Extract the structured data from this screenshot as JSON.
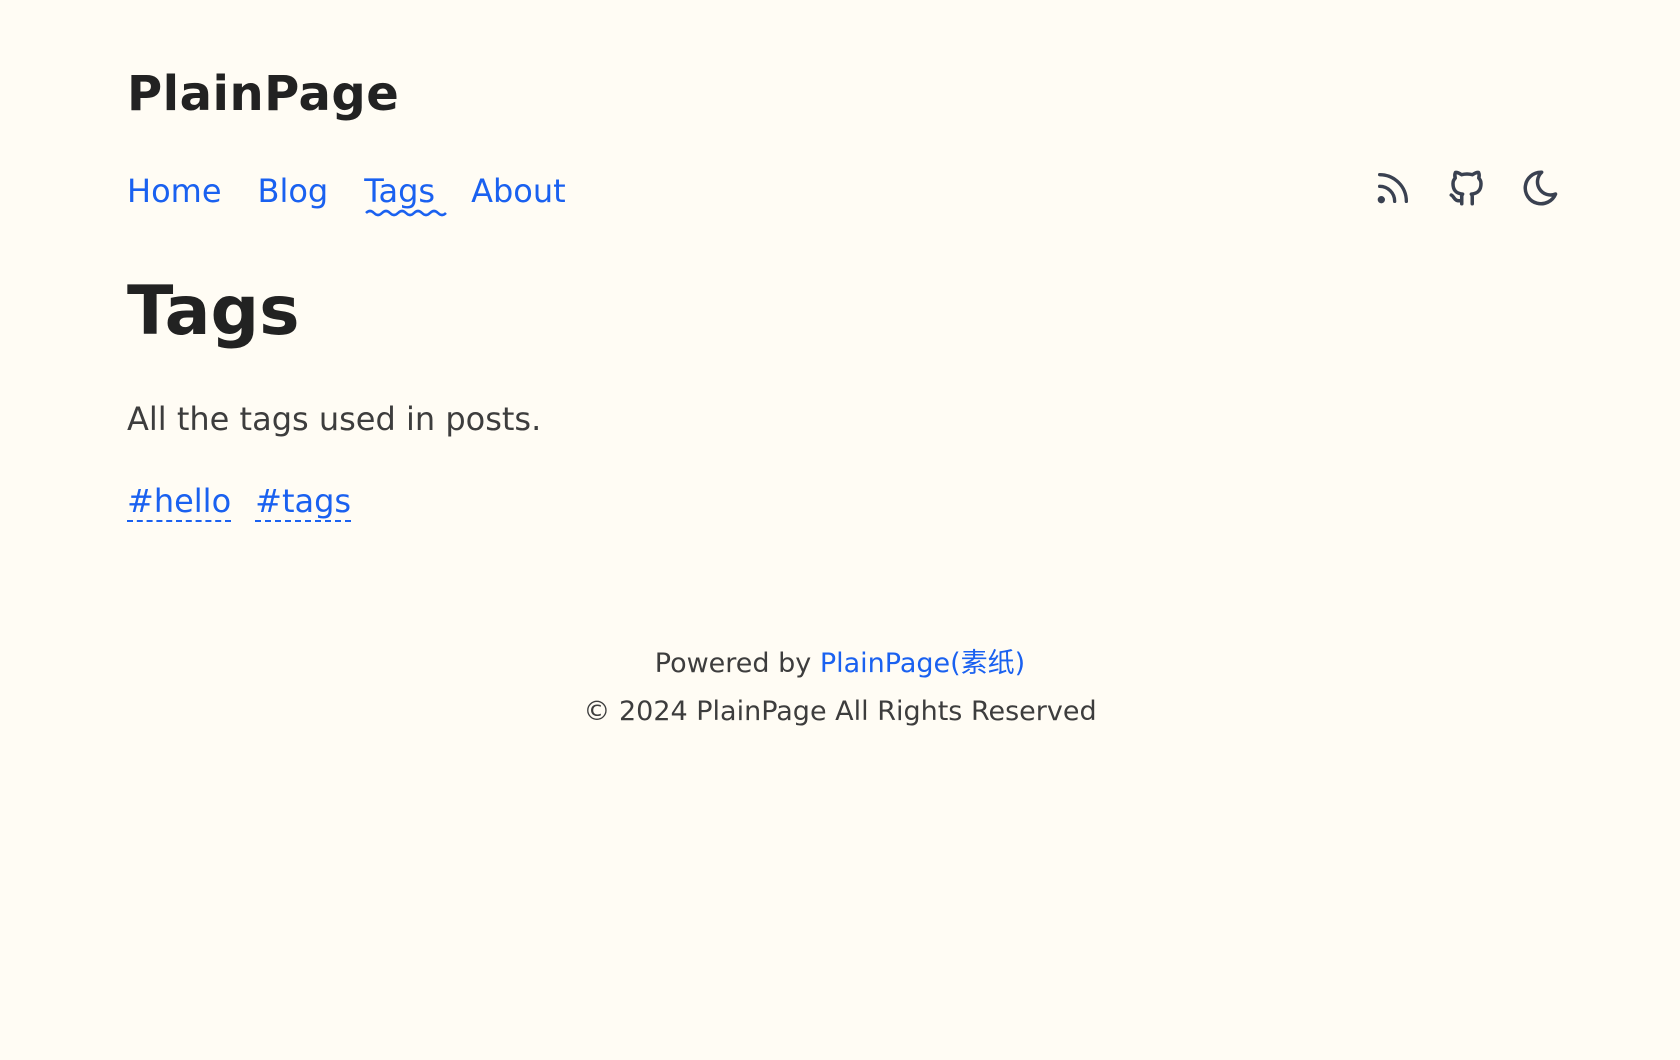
{
  "site": {
    "title": "PlainPage"
  },
  "nav": {
    "items": [
      {
        "label": "Home",
        "active": false
      },
      {
        "label": "Blog",
        "active": false
      },
      {
        "label": "Tags",
        "active": true
      },
      {
        "label": "About",
        "active": false
      }
    ]
  },
  "header_icons": [
    {
      "name": "rss-icon"
    },
    {
      "name": "github-icon"
    },
    {
      "name": "moon-icon"
    }
  ],
  "page": {
    "title": "Tags",
    "description": "All the tags used in posts."
  },
  "tags": [
    {
      "label": "#hello"
    },
    {
      "label": "#tags"
    }
  ],
  "footer": {
    "powered_prefix": "Powered by ",
    "powered_link": "PlainPage(素纸)",
    "copyright": "© 2024 PlainPage All Rights Reserved"
  },
  "colors": {
    "background": "#fffcf4",
    "accent": "#1a61f0",
    "text": "#222222",
    "muted_text": "#3d3d3d",
    "icon": "#3a4150"
  }
}
